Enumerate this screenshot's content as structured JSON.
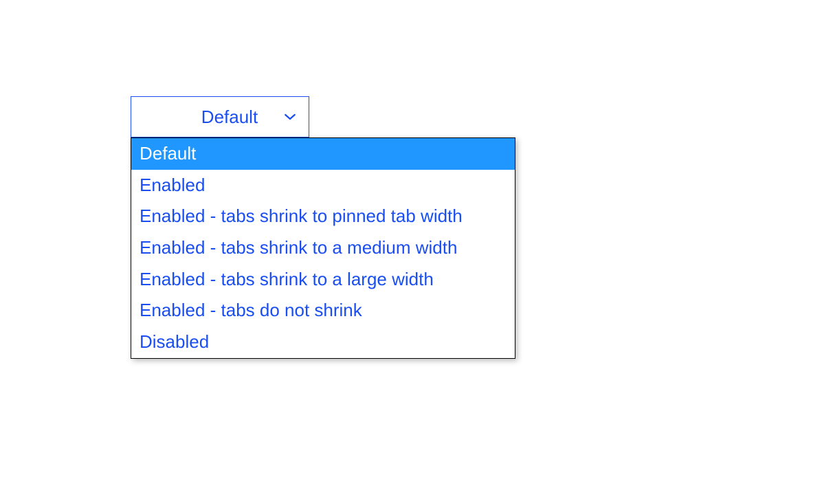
{
  "dropdown": {
    "selected_label": "Default",
    "options": [
      {
        "label": "Default",
        "selected": true
      },
      {
        "label": "Enabled",
        "selected": false
      },
      {
        "label": "Enabled - tabs shrink to pinned tab width",
        "selected": false
      },
      {
        "label": "Enabled - tabs shrink to a medium width",
        "selected": false
      },
      {
        "label": "Enabled - tabs shrink to a large width",
        "selected": false
      },
      {
        "label": "Enabled - tabs do not shrink",
        "selected": false
      },
      {
        "label": "Disabled",
        "selected": false
      }
    ]
  }
}
